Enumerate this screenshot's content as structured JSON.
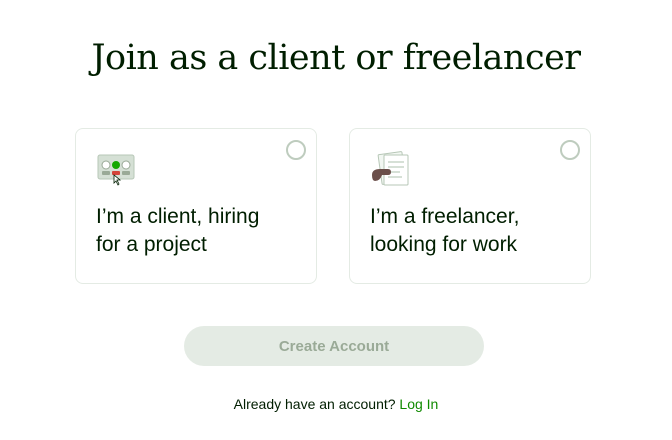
{
  "page": {
    "title": "Join as a client or freelancer"
  },
  "options": [
    {
      "label_line1": "I’m a client, hiring",
      "label_line2": "for a project",
      "icon": "client-hiring-icon"
    },
    {
      "label_line1": "I’m a freelancer,",
      "label_line2": "looking for work",
      "icon": "freelancer-work-icon"
    }
  ],
  "actions": {
    "create_account": "Create Account"
  },
  "footer": {
    "prompt": "Already have an account?",
    "login_link": "Log In"
  },
  "colors": {
    "brand_green": "#108a00",
    "text_dark": "#001e00",
    "button_disabled_bg": "#e4ebe4",
    "button_disabled_text": "#9aaa97"
  }
}
